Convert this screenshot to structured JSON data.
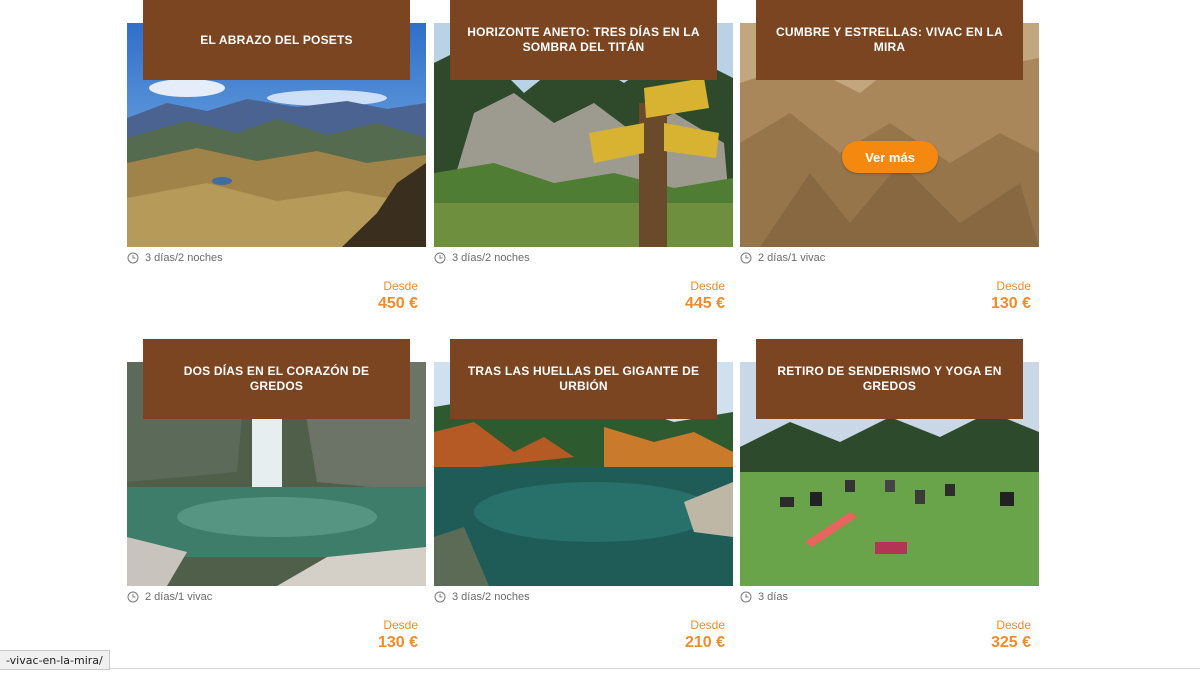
{
  "cards": [
    {
      "title": "EL ABRAZO DEL POSETS",
      "duration": "3 días/2 noches",
      "desde": "Desde",
      "price": "450 €"
    },
    {
      "title": "HORIZONTE ANETO: TRES DÍAS EN LA SOMBRA DEL TITÁN",
      "duration": "3 días/2 noches",
      "desde": "Desde",
      "price": "445 €"
    },
    {
      "title": "CUMBRE Y ESTRELLAS: VIVAC EN LA MIRA",
      "duration": "2 días/1 vivac",
      "desde": "Desde",
      "price": "130 €",
      "hover_button": "Ver más"
    },
    {
      "title": "DOS DÍAS EN EL CORAZÓN DE GREDOS",
      "duration": "2 días/1 vivac",
      "desde": "Desde",
      "price": "130 €"
    },
    {
      "title": "TRAS LAS HUELLAS DEL GIGANTE DE URBIÓN",
      "duration": "3 días/2 noches",
      "desde": "Desde",
      "price": "210 €"
    },
    {
      "title": "RETIRO DE SENDERISMO Y YOGA EN GREDOS",
      "duration": "3 días",
      "desde": "Desde",
      "price": "325 €"
    }
  ],
  "status_url": "-vivac-en-la-mira/",
  "colors": {
    "title_bg": "#7a4520",
    "price": "#f28c28",
    "button": "#f5890f"
  }
}
